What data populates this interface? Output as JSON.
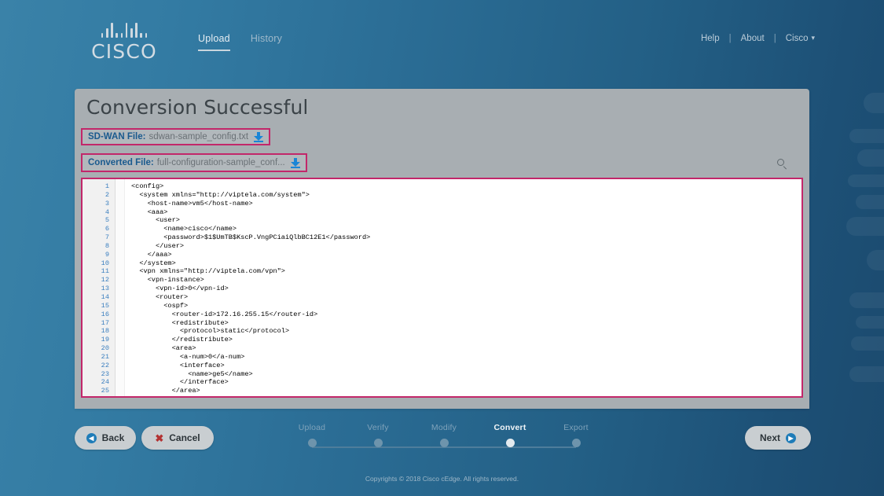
{
  "brand": {
    "logo_text": "CISCO",
    "logo_icon": "cisco-bars-logo"
  },
  "nav": {
    "tabs": [
      {
        "label": "Upload",
        "active": true
      },
      {
        "label": "History",
        "active": false
      }
    ],
    "right": {
      "help": "Help",
      "sep1": "|",
      "about": "About",
      "sep2": "|",
      "account": "Cisco",
      "caret": "⌄"
    }
  },
  "card": {
    "title": "Conversion Successful",
    "sdwan": {
      "label": "SD-WAN File:",
      "filename": "sdwan-sample_config.txt",
      "download_icon": "download-icon"
    },
    "converted": {
      "label": "Converted File:",
      "filename": "full-configuration-sample_conf...",
      "download_icon": "download-icon"
    },
    "search_icon": "search-icon"
  },
  "code": {
    "line_numbers": [
      1,
      2,
      3,
      4,
      5,
      6,
      7,
      8,
      9,
      10,
      11,
      12,
      13,
      14,
      15,
      16,
      17,
      18,
      19,
      20,
      21,
      22,
      23,
      24,
      25
    ],
    "lines": [
      "<config>",
      "  <system xmlns=\"http://viptela.com/system\">",
      "    <host-name>vm5</host-name>",
      "    <aaa>",
      "      <user>",
      "        <name>cisco</name>",
      "        <password>$1$UmTB$KscP.VngPCiaiQlbBC12E1</password>",
      "      </user>",
      "    </aaa>",
      "  </system>",
      "  <vpn xmlns=\"http://viptela.com/vpn\">",
      "    <vpn-instance>",
      "      <vpn-id>0</vpn-id>",
      "      <router>",
      "        <ospf>",
      "          <router-id>172.16.255.15</router-id>",
      "          <redistribute>",
      "            <protocol>static</protocol>",
      "          </redistribute>",
      "          <area>",
      "            <a-num>0</a-num>",
      "            <interface>",
      "              <name>ge5</name>",
      "            </interface>",
      "          </area>"
    ]
  },
  "actions": {
    "back": {
      "label": "Back",
      "icon": "chevron-left-circle-icon"
    },
    "cancel": {
      "label": "Cancel",
      "icon": "close-x-icon"
    },
    "next": {
      "label": "Next",
      "icon": "chevron-right-circle-icon"
    }
  },
  "stepper": {
    "steps": [
      {
        "label": "Upload",
        "active": false
      },
      {
        "label": "Verify",
        "active": false
      },
      {
        "label": "Modify",
        "active": false
      },
      {
        "label": "Convert",
        "active": true
      },
      {
        "label": "Export",
        "active": false
      }
    ]
  },
  "footer": {
    "copyright": "Copyrights © 2018 Cisco cEdge. All rights reserved."
  },
  "colors": {
    "accent_pink": "#c2276a",
    "brand_blue": "#1a5a8e",
    "download_blue": "#1a85d6",
    "card_gray": "#a8aeb2"
  }
}
